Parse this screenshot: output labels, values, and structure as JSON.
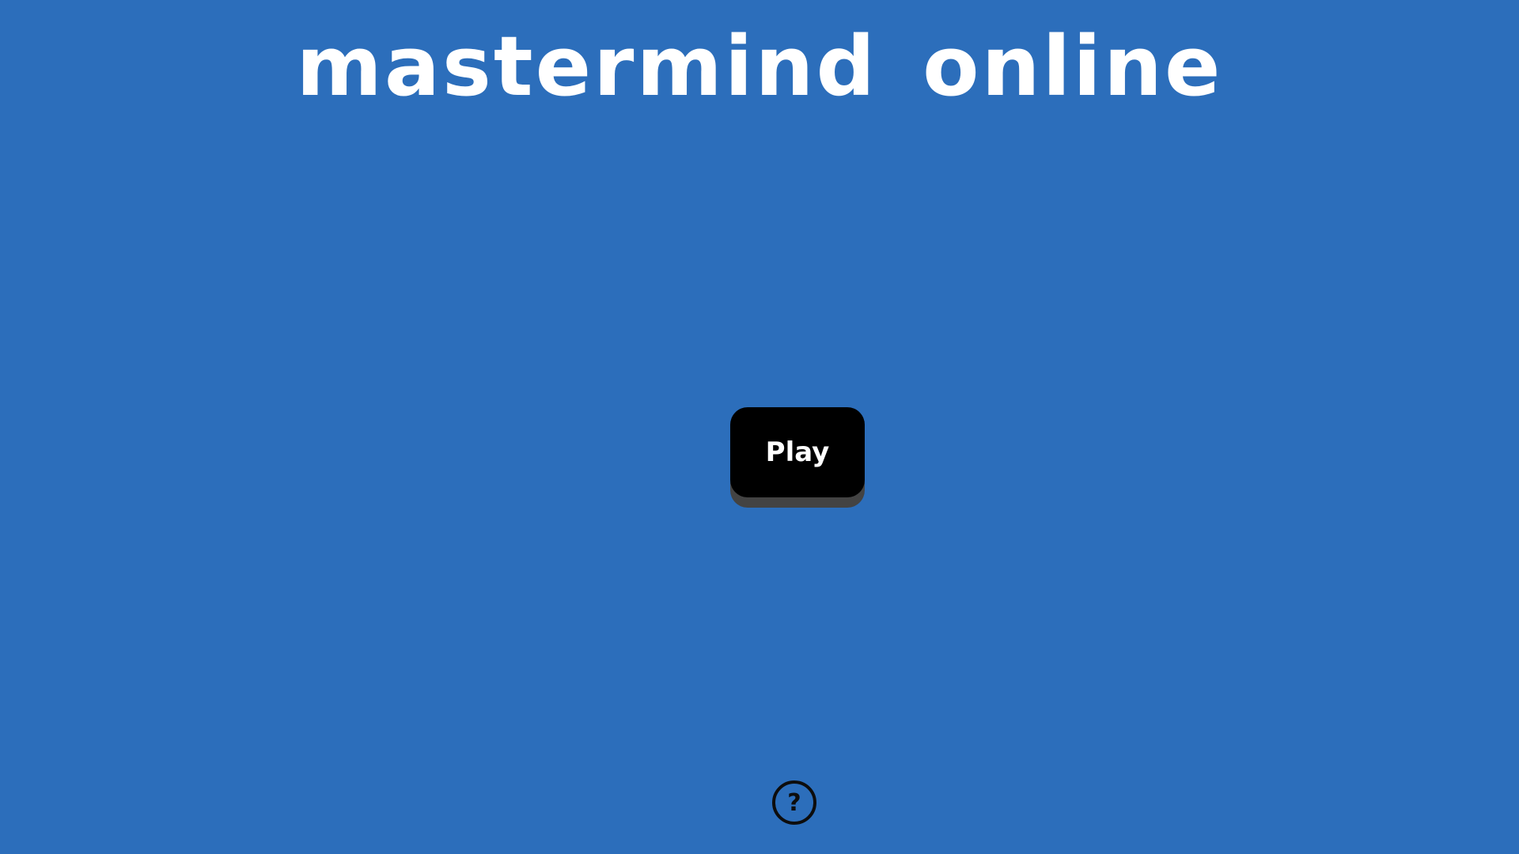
{
  "app": {
    "title": "mastermind online"
  },
  "main": {
    "play_label": "Play"
  },
  "footer": {
    "help_glyph": "?",
    "help_icon": "question-circle-icon"
  },
  "colors": {
    "background": "#2c6ebb",
    "title_text": "#ffffff",
    "button_bg": "#000000",
    "button_shadow": "#434343",
    "button_text": "#ffffff",
    "help_icon": "#0d0d0d"
  }
}
